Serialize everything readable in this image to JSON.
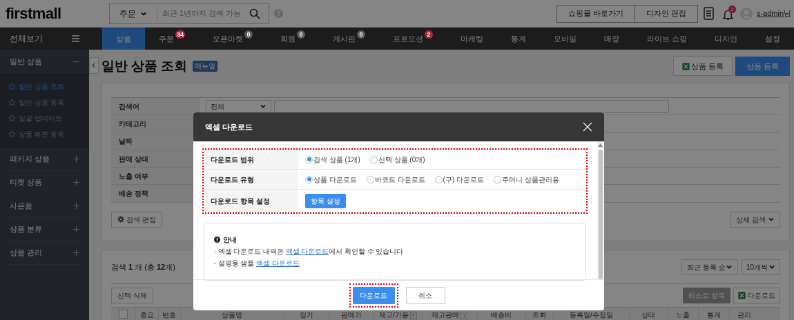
{
  "header": {
    "logo": "firstmall",
    "search_category": "주문",
    "search_placeholder": "최근 1년까지 검색 가능",
    "buttons": [
      "쇼핑몰 바로가기",
      "디자인 편집"
    ],
    "notification_count": "2",
    "user": "s-admin",
    "user_suffix": "님"
  },
  "nav": {
    "tabs": [
      {
        "label": "상품",
        "selected": true
      },
      {
        "label": "주문",
        "selected": false,
        "badge": "34",
        "color": "#b4213f"
      },
      {
        "label": "오픈마켓",
        "selected": false,
        "badge": "0",
        "color": "#5c5c5c"
      },
      {
        "label": "회원",
        "selected": false,
        "badge": "0",
        "color": "#5c5c5c"
      },
      {
        "label": "게시판",
        "selected": false,
        "badge": "0",
        "color": "#5c5c5c"
      },
      {
        "label": "프로모션",
        "selected": false,
        "badge": "2",
        "color": "#b4213f"
      },
      {
        "label": "마케팅",
        "selected": false
      },
      {
        "label": "통계",
        "selected": false
      },
      {
        "label": "모바일",
        "selected": false
      },
      {
        "label": "매장",
        "selected": false
      },
      {
        "label": "라이브 쇼핑",
        "selected": false
      },
      {
        "label": "디자인",
        "selected": false
      },
      {
        "label": "설정",
        "selected": false
      }
    ]
  },
  "sidebar": {
    "title": "전체보기",
    "sections": [
      {
        "label": "일반 상품",
        "expanded": true,
        "children": [
          {
            "label": "일반 상품 조회",
            "selected": true
          },
          {
            "label": "일반 상품 등록",
            "selected": false
          },
          {
            "label": "일괄 업데이트",
            "selected": false
          },
          {
            "label": "상품 빠른 등록",
            "selected": false
          }
        ]
      },
      {
        "label": "패키지 상품",
        "expanded": false
      },
      {
        "label": "티켓 상품",
        "expanded": false
      },
      {
        "label": "사은품",
        "expanded": false
      },
      {
        "label": "상품 분류",
        "expanded": false
      },
      {
        "label": "상품 관리",
        "expanded": false
      }
    ]
  },
  "page": {
    "title": "일반 상품 조회",
    "manual_badge": "매뉴얼",
    "buttons": [
      {
        "label": "상품 등록",
        "kind": "excel"
      },
      {
        "label": "상품 등록",
        "kind": "primary"
      }
    ]
  },
  "search_form": {
    "rows": [
      {
        "label": "검색어"
      },
      {
        "label": "카테고리"
      },
      {
        "label": "날짜"
      },
      {
        "label": "판매 상태"
      },
      {
        "label": "노출 여부"
      },
      {
        "label": "배송 정책"
      }
    ],
    "keyword_scope": "전체",
    "edit_button": "검색 편집",
    "detail_button": "상세 검색"
  },
  "results": {
    "select_all_checked": false,
    "count_text": "검색 **1** 개 (총 **12**개)",
    "sort": "최근 등록 순",
    "per_page": "10개씩",
    "delete_button": "선택 삭제",
    "list_button": "리스트 항목",
    "download_button": "다운로드",
    "columns": [
      {
        "label": "중요"
      },
      {
        "label": "번호"
      },
      {
        "label": "상품명"
      },
      {
        "label": "정가"
      },
      {
        "label": "판매가"
      },
      {
        "label": "재고/가용",
        "help": "?"
      },
      {
        "label": "재고판매",
        "help": "?"
      },
      {
        "label": "배송비"
      },
      {
        "label": "조회"
      },
      {
        "label": "등록일/수정일"
      },
      {
        "label": "상태"
      },
      {
        "label": "노출"
      },
      {
        "label": "통계"
      },
      {
        "label": "관리"
      }
    ]
  },
  "dialog": {
    "title": "엑셀 다운로드",
    "highlighted": true,
    "rows": [
      {
        "label": "다운로드 범위",
        "kind": "radio",
        "options": [
          {
            "label": "검색 상품 (1개)",
            "selected": true
          },
          {
            "label": "선택 상품 (0개)",
            "selected": false
          }
        ]
      },
      {
        "label": "다운로드 유형",
        "kind": "radio",
        "options": [
          {
            "label": "상품 다운로드",
            "selected": true
          },
          {
            "label": "바코드 다운로드",
            "selected": false
          },
          {
            "label": "(구) 다운로드",
            "selected": false
          },
          {
            "label": "주머니 상품관리용",
            "selected": false
          }
        ]
      },
      {
        "label": "다운로드 항목 설정",
        "kind": "button",
        "button": "항목 설정"
      }
    ],
    "notice": {
      "title": "안내",
      "lines": [
        {
          "before": "- 엑셀 다운로드 내역은 ",
          "link": "엑셀 다운로드",
          "after": "에서 확인할 수 있습니다"
        },
        {
          "before": "- 설명용 샘플 ",
          "link": "엑셀 다운로드"
        }
      ]
    },
    "buttons": [
      {
        "label": "다운로드",
        "kind": "primary",
        "highlighted": true
      },
      {
        "label": "취소",
        "kind": "secondary",
        "highlighted": false
      }
    ]
  }
}
